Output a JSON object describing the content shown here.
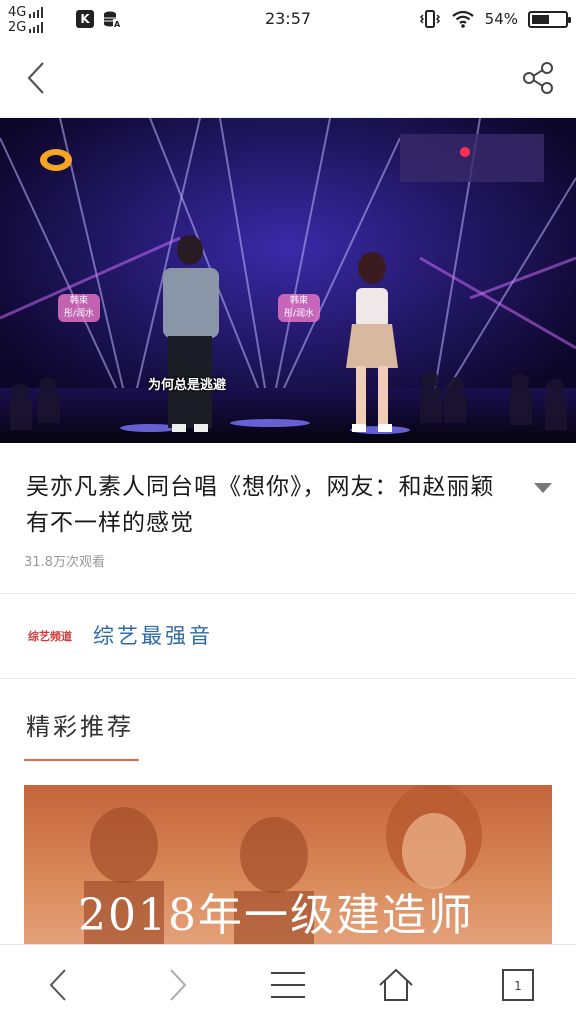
{
  "status_bar": {
    "network_top": "4G",
    "network_bottom": "2G",
    "app_k_label": "K",
    "time": "23:57",
    "battery_percent": "54%",
    "battery_level": 0.54,
    "icons": [
      "signal-icon",
      "k-app-icon",
      "database-icon",
      "vibrate-icon",
      "wifi-icon",
      "battery-icon"
    ]
  },
  "nav": {
    "icons": [
      "back-icon",
      "share-icon"
    ]
  },
  "video": {
    "caption": "为何总是逃避",
    "tag_left_top": "韩束",
    "tag_left_bottom": "彤/润水",
    "tag_right_top": "韩束",
    "tag_right_bottom": "彤/润水",
    "background_color": "#120a3a",
    "logo_color": "#f5a623"
  },
  "article": {
    "title": "吴亦凡素人同台唱《想你》，网友：和赵丽颖有不一样的感觉",
    "views": "31.8万次观看",
    "expand_icon": "chevron-down-icon"
  },
  "channel": {
    "avatar_text": "综艺频道",
    "name": "综艺最强音",
    "name_color": "#2e6aa8"
  },
  "recommend": {
    "heading": "精彩推荐",
    "underline_color": "#e8674a",
    "card_text": "2018年一级建造师"
  },
  "toolbar": {
    "icons": [
      "back-icon",
      "forward-icon",
      "menu-icon",
      "home-icon",
      "tabs-icon"
    ],
    "tab_count": "1"
  }
}
